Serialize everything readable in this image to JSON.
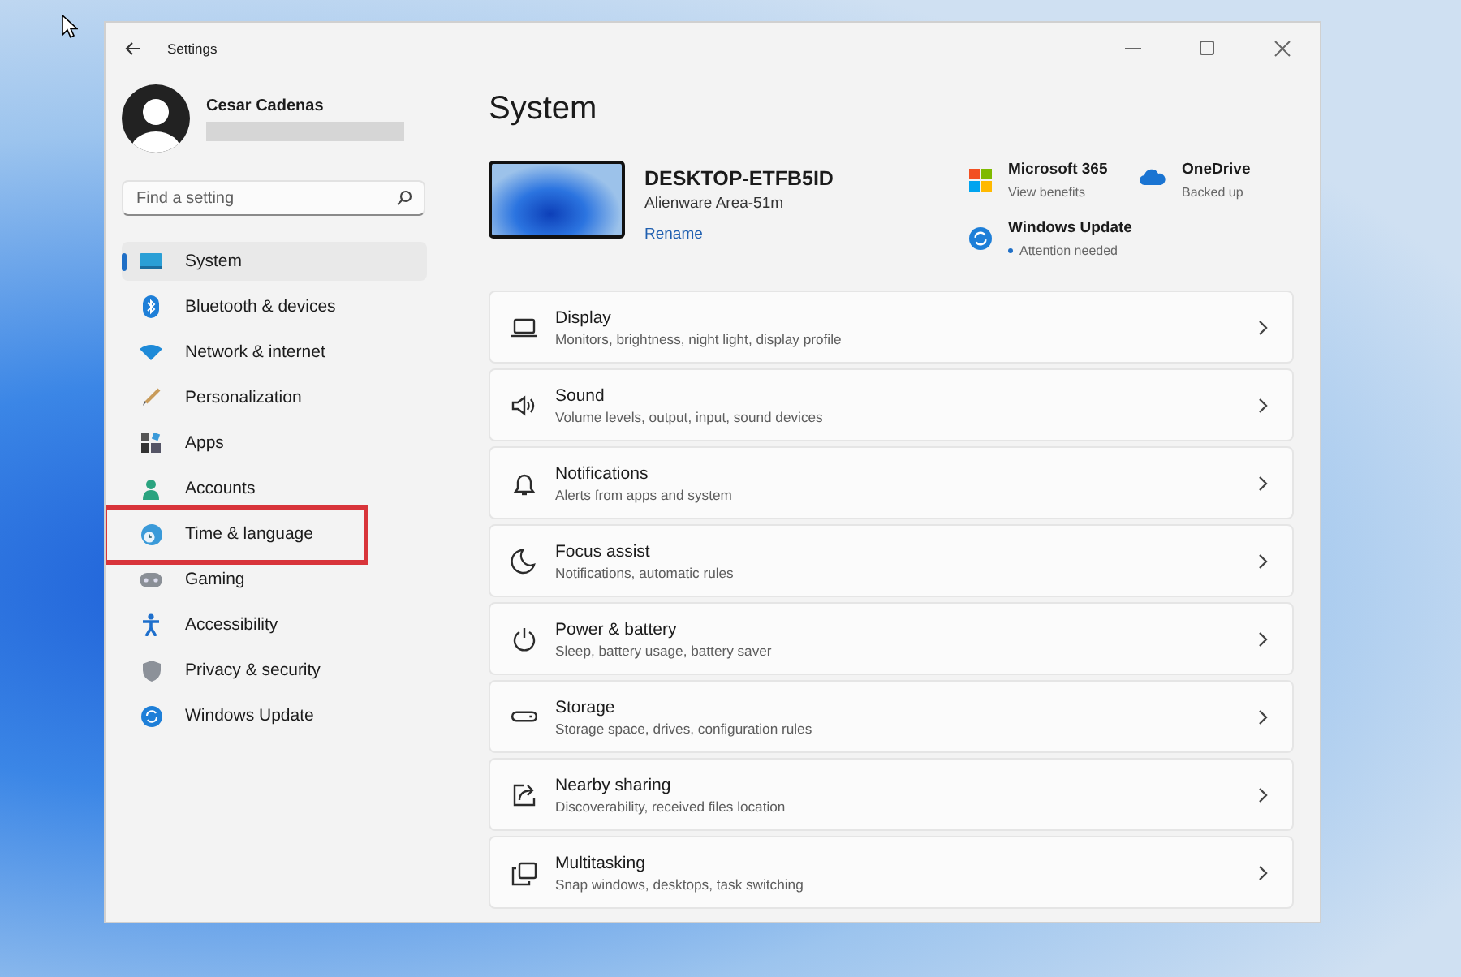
{
  "window": {
    "title": "Settings"
  },
  "account": {
    "name": "Cesar Cadenas"
  },
  "search": {
    "placeholder": "Find a setting"
  },
  "sidebar": {
    "items": [
      {
        "label": "System",
        "selected": true,
        "highlighted": false
      },
      {
        "label": "Bluetooth & devices",
        "selected": false,
        "highlighted": false
      },
      {
        "label": "Network & internet",
        "selected": false,
        "highlighted": false
      },
      {
        "label": "Personalization",
        "selected": false,
        "highlighted": false
      },
      {
        "label": "Apps",
        "selected": false,
        "highlighted": false
      },
      {
        "label": "Accounts",
        "selected": false,
        "highlighted": false
      },
      {
        "label": "Time & language",
        "selected": false,
        "highlighted": true
      },
      {
        "label": "Gaming",
        "selected": false,
        "highlighted": false
      },
      {
        "label": "Accessibility",
        "selected": false,
        "highlighted": false
      },
      {
        "label": "Privacy & security",
        "selected": false,
        "highlighted": false
      },
      {
        "label": "Windows Update",
        "selected": false,
        "highlighted": false
      }
    ]
  },
  "page": {
    "title": "System"
  },
  "device": {
    "name": "DESKTOP-ETFB5ID",
    "model": "Alienware Area-51m",
    "rename": "Rename"
  },
  "services": [
    {
      "title": "Microsoft 365",
      "subtitle": "View benefits",
      "attention": false
    },
    {
      "title": "OneDrive",
      "subtitle": "Backed up",
      "attention": false
    },
    {
      "title": "Windows Update",
      "subtitle": "Attention needed",
      "attention": true
    }
  ],
  "settings": [
    {
      "title": "Display",
      "subtitle": "Monitors, brightness, night light, display profile"
    },
    {
      "title": "Sound",
      "subtitle": "Volume levels, output, input, sound devices"
    },
    {
      "title": "Notifications",
      "subtitle": "Alerts from apps and system"
    },
    {
      "title": "Focus assist",
      "subtitle": "Notifications, automatic rules"
    },
    {
      "title": "Power & battery",
      "subtitle": "Sleep, battery usage, battery saver"
    },
    {
      "title": "Storage",
      "subtitle": "Storage space, drives, configuration rules"
    },
    {
      "title": "Nearby sharing",
      "subtitle": "Discoverability, received files location"
    },
    {
      "title": "Multitasking",
      "subtitle": "Snap windows, desktops, task switching"
    }
  ]
}
